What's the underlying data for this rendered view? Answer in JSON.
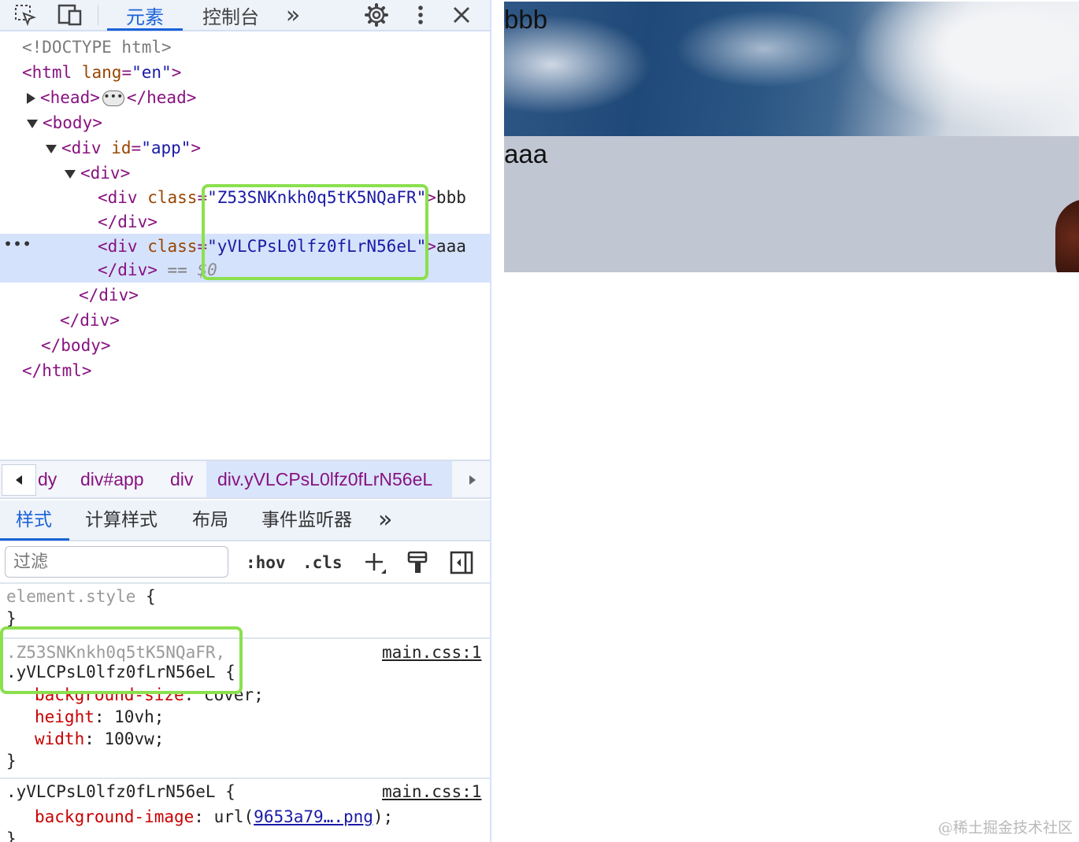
{
  "toolbar": {
    "tabs": [
      "元素",
      "控制台"
    ],
    "more": "»",
    "icons": [
      "inspect-icon",
      "device-toggle-icon",
      "gear-icon",
      "kebab-menu-icon",
      "close-icon"
    ]
  },
  "dom": {
    "doctype": "<!DOCTYPE html>",
    "html_open": "<html",
    "html_lang_attr": "lang",
    "html_lang_val": "\"en\"",
    "html_close_bracket": ">",
    "head_open": "<head>",
    "head_close": "</head>",
    "ellipsis": "•••",
    "body_open": "<body>",
    "div_app_open": "<div",
    "div_app_attr": "id",
    "div_app_val": "\"app\"",
    "div_open": "<div>",
    "div1_tag": "<div",
    "div1_attr": "class",
    "div1_val": "\"Z53SNKnkh0q5tK5NQaFR\"",
    "div1_text": "bbb",
    "div_close": "</div>",
    "div2_tag": "<div",
    "div2_attr": "class",
    "div2_val": "\"yVLCPsL0lfz0fLrN56eL\"",
    "div2_text": "aaa",
    "div2_close": "</div>",
    "eq": "==",
    "dollar0": "$0",
    "body_close": "</body>",
    "html_close": "</html>",
    "row_dots": "•••"
  },
  "breadcrumb": {
    "items": [
      "dy",
      "div#app",
      "div",
      "div.yVLCPsL0lfz0fLrN56eL"
    ]
  },
  "styles_tabs": {
    "tabs": [
      "样式",
      "计算样式",
      "布局",
      "事件监听器"
    ],
    "more": "»"
  },
  "filter": {
    "placeholder": "过滤",
    "hov": ":hov",
    "cls": ".cls"
  },
  "rules": {
    "element_style": "element.style",
    "open_brace": "{",
    "close_brace": "}",
    "rule1_selector_dim": ".Z53SNKnkh0q5tK5NQaFR,",
    "rule1_selector": ".yVLCPsL0lfz0fLrN56eL",
    "rule1_source": "main.css:1",
    "rule1_props": [
      {
        "name": "background-size",
        "value": "cover"
      },
      {
        "name": "height",
        "value": "10vh"
      },
      {
        "name": "width",
        "value": "100vw"
      }
    ],
    "rule2_selector": ".yVLCPsL0lfz0fLrN56eL",
    "rule2_source": "main.css:1",
    "rule2_prop_name": "background-image",
    "rule2_url_prefix": "url(",
    "rule2_url": "9653a79….png",
    "rule2_url_suffix": ");"
  },
  "viewport": {
    "text_top": "bbb",
    "text_bottom": "aaa"
  },
  "watermark": "@稀土掘金技术社区",
  "colors": {
    "accent": "#1a63d8",
    "highlight_box": "#8be04e",
    "selected_row": "#d5e2fb"
  }
}
